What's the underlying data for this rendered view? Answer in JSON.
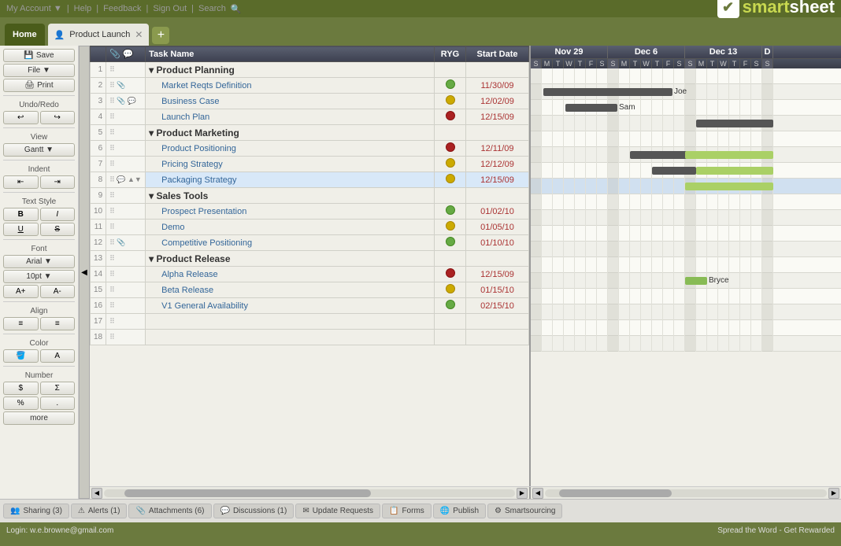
{
  "topbar": {
    "my_account": "My Account ▼",
    "help": "Help",
    "feedback": "Feedback",
    "sign_out": "Sign Out",
    "search": "Search"
  },
  "tabs": {
    "home": "Home",
    "sheet": "Product Launch",
    "add": "+"
  },
  "logo": {
    "brand": "smartsheet",
    "check": "✔"
  },
  "toolbar": {
    "save": "Save",
    "file": "File ▼",
    "print": "Print",
    "undo_redo": "Undo/Redo",
    "view": "View",
    "gantt": "Gantt ▼",
    "indent": "Indent",
    "text_style": "Text Style",
    "bold": "B",
    "italic": "I",
    "underline": "U",
    "strikethrough": "S",
    "font": "Font",
    "arial": "Arial ▼",
    "size": "10pt ▼",
    "increase_font": "A+",
    "decrease_font": "A-",
    "align": "Align",
    "color": "Color",
    "number": "Number",
    "dollar": "$",
    "sigma": "Σ",
    "percent": "%",
    "decimal": ".",
    "more": "more"
  },
  "grid": {
    "columns": {
      "task_name": "Task Name",
      "ryg": "RYG",
      "start_date": "Start Date"
    },
    "months": [
      {
        "label": "Nov 29",
        "days": 7,
        "offset": 0
      },
      {
        "label": "Dec 6",
        "days": 7,
        "offset": 7
      },
      {
        "label": "Dec 13",
        "days": 7,
        "offset": 14
      },
      {
        "label": "D",
        "days": 1,
        "offset": 21
      }
    ],
    "day_headers": [
      "S",
      "M",
      "T",
      "W",
      "T",
      "F",
      "S",
      "S",
      "M",
      "T",
      "W",
      "T",
      "F",
      "S",
      "S",
      "M",
      "T",
      "W",
      "T",
      "F",
      "S",
      "S"
    ],
    "rows": [
      {
        "num": 1,
        "indent": 0,
        "name": "Product Planning",
        "ryg": "",
        "date": "",
        "section": true
      },
      {
        "num": 2,
        "indent": 1,
        "name": "Market Reqts Definition",
        "ryg": "green",
        "date": "11/30/09"
      },
      {
        "num": 3,
        "indent": 1,
        "name": "Business Case",
        "ryg": "yellow",
        "date": "12/02/09"
      },
      {
        "num": 4,
        "indent": 1,
        "name": "Launch Plan",
        "ryg": "red",
        "date": "12/15/09"
      },
      {
        "num": 5,
        "indent": 0,
        "name": "Product Marketing",
        "ryg": "",
        "date": "",
        "section": true
      },
      {
        "num": 6,
        "indent": 1,
        "name": "Product Positioning",
        "ryg": "red",
        "date": "12/11/09"
      },
      {
        "num": 7,
        "indent": 1,
        "name": "Pricing Strategy",
        "ryg": "yellow",
        "date": "12/12/09"
      },
      {
        "num": 8,
        "indent": 1,
        "name": "Packaging Strategy",
        "ryg": "yellow",
        "date": "12/15/09",
        "selected": true
      },
      {
        "num": 9,
        "indent": 0,
        "name": "Sales Tools",
        "ryg": "",
        "date": "",
        "section": true
      },
      {
        "num": 10,
        "indent": 1,
        "name": "Prospect Presentation",
        "ryg": "green",
        "date": "01/02/10"
      },
      {
        "num": 11,
        "indent": 1,
        "name": "Demo",
        "ryg": "yellow",
        "date": "01/05/10"
      },
      {
        "num": 12,
        "indent": 1,
        "name": "Competitive Positioning",
        "ryg": "green",
        "date": "01/10/10"
      },
      {
        "num": 13,
        "indent": 0,
        "name": "Product Release",
        "ryg": "",
        "date": "",
        "section": true
      },
      {
        "num": 14,
        "indent": 1,
        "name": "Alpha Release",
        "ryg": "red",
        "date": "12/15/09"
      },
      {
        "num": 15,
        "indent": 1,
        "name": "Beta Release",
        "ryg": "yellow",
        "date": "01/15/10"
      },
      {
        "num": 16,
        "indent": 1,
        "name": "V1 General Availability",
        "ryg": "green",
        "date": "02/15/10"
      },
      {
        "num": 17,
        "indent": 0,
        "name": "",
        "ryg": "",
        "date": ""
      },
      {
        "num": 18,
        "indent": 0,
        "name": "",
        "ryg": "",
        "date": ""
      }
    ]
  },
  "bottom_tabs": [
    {
      "icon": "share",
      "label": "Sharing (3)"
    },
    {
      "icon": "alert",
      "label": "Alerts (1)"
    },
    {
      "icon": "attach",
      "label": "Attachments (6)"
    },
    {
      "icon": "discuss",
      "label": "Discussions (1)"
    },
    {
      "icon": "update",
      "label": "Update Requests"
    },
    {
      "icon": "form",
      "label": "Forms"
    },
    {
      "icon": "publish",
      "label": "Publish"
    },
    {
      "icon": "smart",
      "label": "Smartsourcing"
    }
  ],
  "status_bar": {
    "left": "Login: w.e.browne@gmail.com",
    "right": "Spread the Word - Get Rewarded"
  }
}
